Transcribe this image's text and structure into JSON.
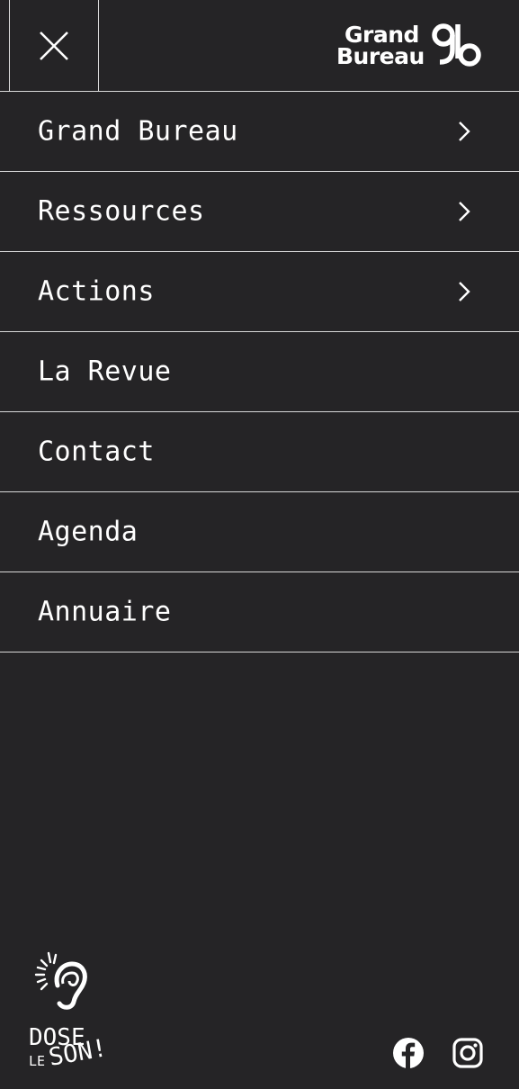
{
  "header": {
    "close_icon": "close-icon",
    "logo": {
      "line1": "Grand",
      "line2": "Bureau",
      "mark": "gb-monogram"
    }
  },
  "menu": {
    "items": [
      {
        "label": "Grand Bureau",
        "has_submenu": true
      },
      {
        "label": "Ressources",
        "has_submenu": true
      },
      {
        "label": "Actions",
        "has_submenu": true
      },
      {
        "label": "La Revue",
        "has_submenu": false
      },
      {
        "label": "Contact",
        "has_submenu": false
      },
      {
        "label": "Agenda",
        "has_submenu": false
      },
      {
        "label": "Annuaire",
        "has_submenu": false
      }
    ],
    "chevron_icon": "chevron-right-icon"
  },
  "footer": {
    "campaign_logo": {
      "line_dose": "DOSE",
      "line_le": "LE",
      "line_son": "SON!"
    },
    "social": [
      {
        "icon": "facebook-icon"
      },
      {
        "icon": "instagram-icon"
      }
    ]
  },
  "colors": {
    "background": "#252426",
    "text": "#ffffff",
    "divider": "#d8d8d8"
  }
}
